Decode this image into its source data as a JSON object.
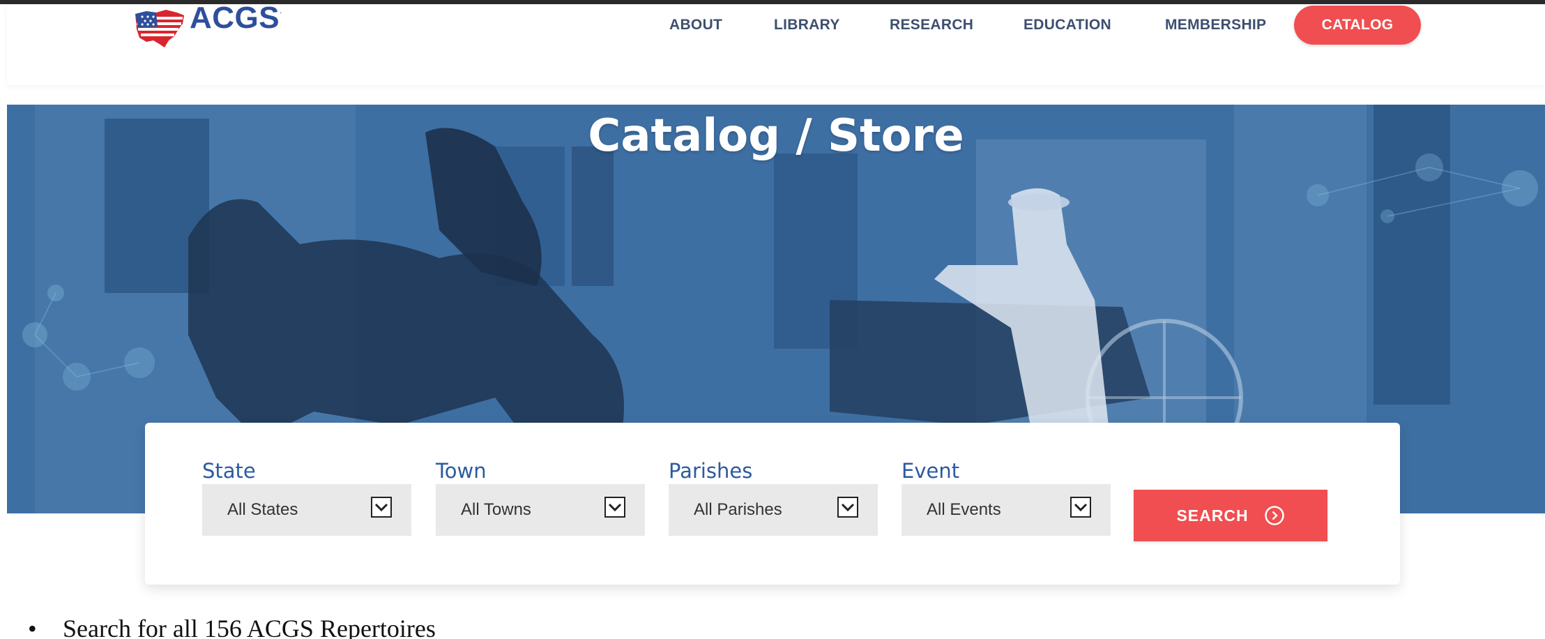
{
  "brand": {
    "name": "ACGS",
    "trademark": ".",
    "colors": {
      "primary": "#2d4f9c",
      "accent": "#f04e50"
    }
  },
  "nav": {
    "items": [
      {
        "label": "ABOUT"
      },
      {
        "label": "LIBRARY"
      },
      {
        "label": "RESEARCH"
      },
      {
        "label": "EDUCATION"
      },
      {
        "label": "MEMBERSHIP"
      }
    ],
    "active": {
      "label": "CATALOG"
    }
  },
  "hero": {
    "title": "Catalog / Store"
  },
  "search": {
    "fields": [
      {
        "label": "State",
        "value": "All States"
      },
      {
        "label": "Town",
        "value": "All Towns"
      },
      {
        "label": "Parishes",
        "value": "All Parishes"
      },
      {
        "label": "Event",
        "value": "All Events"
      }
    ],
    "button_label": "SEARCH",
    "button_icon": "arrow-circle-right-icon"
  },
  "notes": {
    "bullet": "•",
    "text": "Search for all 156 ACGS Repertoires"
  }
}
